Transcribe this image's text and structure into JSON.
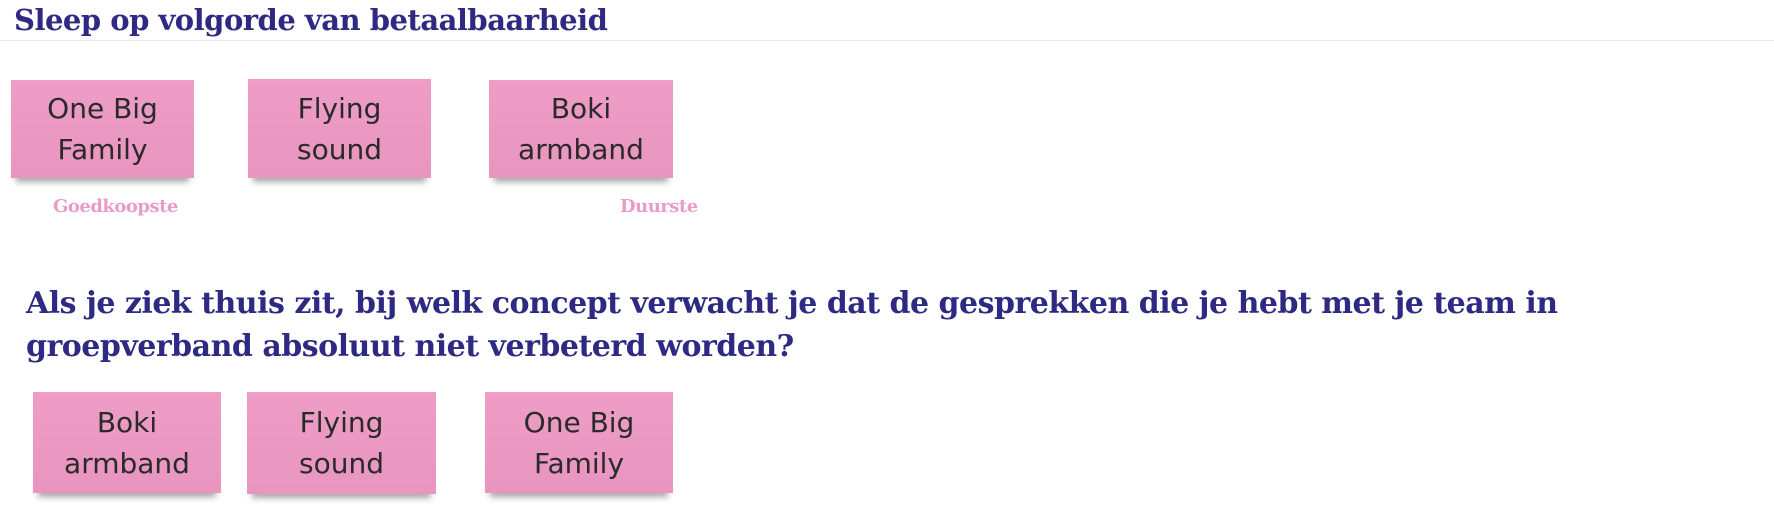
{
  "sort_task": {
    "title": "Sleep op volgorde van betaalbaarheid",
    "notes": [
      {
        "label": "One Big Family"
      },
      {
        "label": "Flying sound"
      },
      {
        "label": "Boki armband"
      }
    ],
    "scale": {
      "low_label": "Goedkoopste",
      "high_label": "Duurste"
    }
  },
  "question_task": {
    "question": "Als je ziek thuis zit, bij welk concept verwacht je dat de gesprekken die je hebt met je team in groepverband absoluut niet verbeterd worden?",
    "notes": [
      {
        "label": "Boki armband"
      },
      {
        "label": "Flying sound"
      },
      {
        "label": "One Big Family"
      }
    ]
  },
  "colors": {
    "heading": "#2e2a83",
    "sticky_note": "#ec9ac4",
    "scale_label": "#e99cc7"
  }
}
